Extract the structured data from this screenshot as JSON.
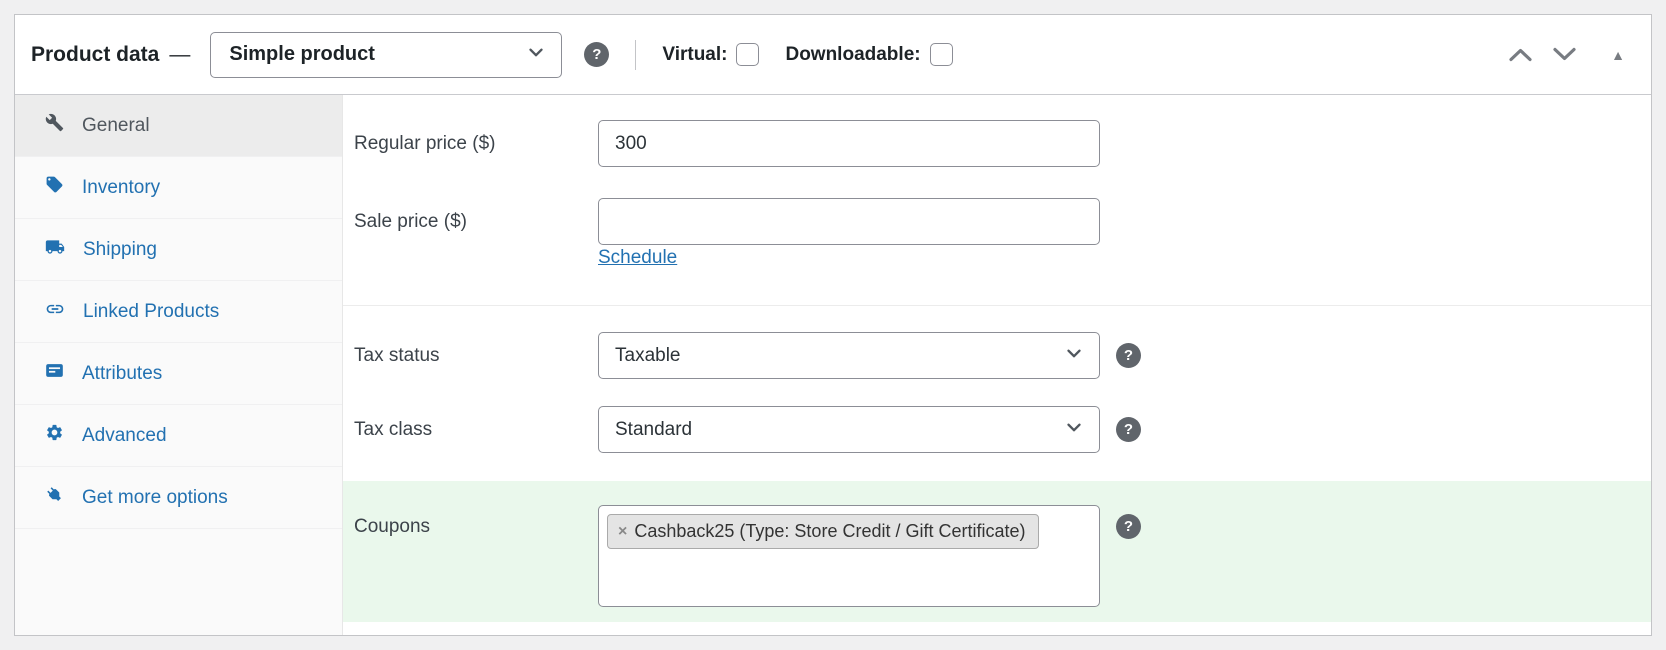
{
  "header": {
    "title": "Product data",
    "dash": "—",
    "product_type": {
      "selected": "Simple product"
    },
    "help_glyph": "?",
    "virtual_label": "Virtual:",
    "downloadable_label": "Downloadable:",
    "toggle_glyph": "▲"
  },
  "sidebar": {
    "items": [
      {
        "label": "General",
        "icon": "wrench-icon",
        "active": true
      },
      {
        "label": "Inventory",
        "icon": "tag-icon",
        "active": false
      },
      {
        "label": "Shipping",
        "icon": "truck-icon",
        "active": false
      },
      {
        "label": "Linked Products",
        "icon": "link-icon",
        "active": false
      },
      {
        "label": "Attributes",
        "icon": "card-icon",
        "active": false
      },
      {
        "label": "Advanced",
        "icon": "gear-icon",
        "active": false
      },
      {
        "label": "Get more options",
        "icon": "plug-icon",
        "active": false
      }
    ]
  },
  "form": {
    "regular_price": {
      "label": "Regular price ($)",
      "value": "300"
    },
    "sale_price": {
      "label": "Sale price ($)",
      "value": "",
      "schedule_link": "Schedule"
    },
    "tax_status": {
      "label": "Tax status",
      "selected": "Taxable"
    },
    "tax_class": {
      "label": "Tax class",
      "selected": "Standard"
    },
    "coupons": {
      "label": "Coupons",
      "chip_remove_glyph": "×",
      "chip_text": "Cashback25 (Type: Store Credit / Gift Certificate)"
    },
    "help_glyph": "?"
  },
  "colors": {
    "link_blue": "#2271b1",
    "active_tab_bg": "#ececec",
    "sidebar_bg": "#fafafa",
    "coupons_row_bg": "#eaf8ec",
    "chip_bg": "#e4e4e4",
    "help_tip_bg": "#60656b",
    "panel_border": "#c3c4c7",
    "field_border": "#8c8e96"
  }
}
